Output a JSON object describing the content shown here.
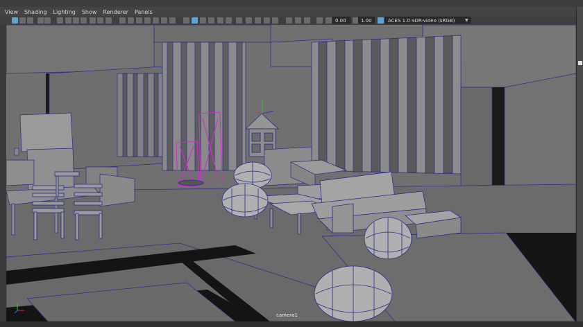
{
  "menu": [
    "View",
    "Shading",
    "Lighting",
    "Show",
    "Renderer",
    "Panels"
  ],
  "toolbar": {
    "value1": "0.00",
    "value2": "1.00",
    "colorspace": "ACES 1.0 SDR-video (sRGB)"
  },
  "viewport": {
    "camera_label": "camera1"
  },
  "icons": [
    "select-icon",
    "move-icon",
    "grid-icon",
    "wireframe-icon",
    "smooth-shade-icon",
    "light-icon",
    "camera-icon",
    "isolate-icon",
    "xray-icon",
    "colorspace-icon",
    "axis-gizmo-icon"
  ],
  "colors": {
    "selection": "#d02bd0",
    "wire": "#2a2a8a",
    "highlight": "#5aa5d8"
  }
}
